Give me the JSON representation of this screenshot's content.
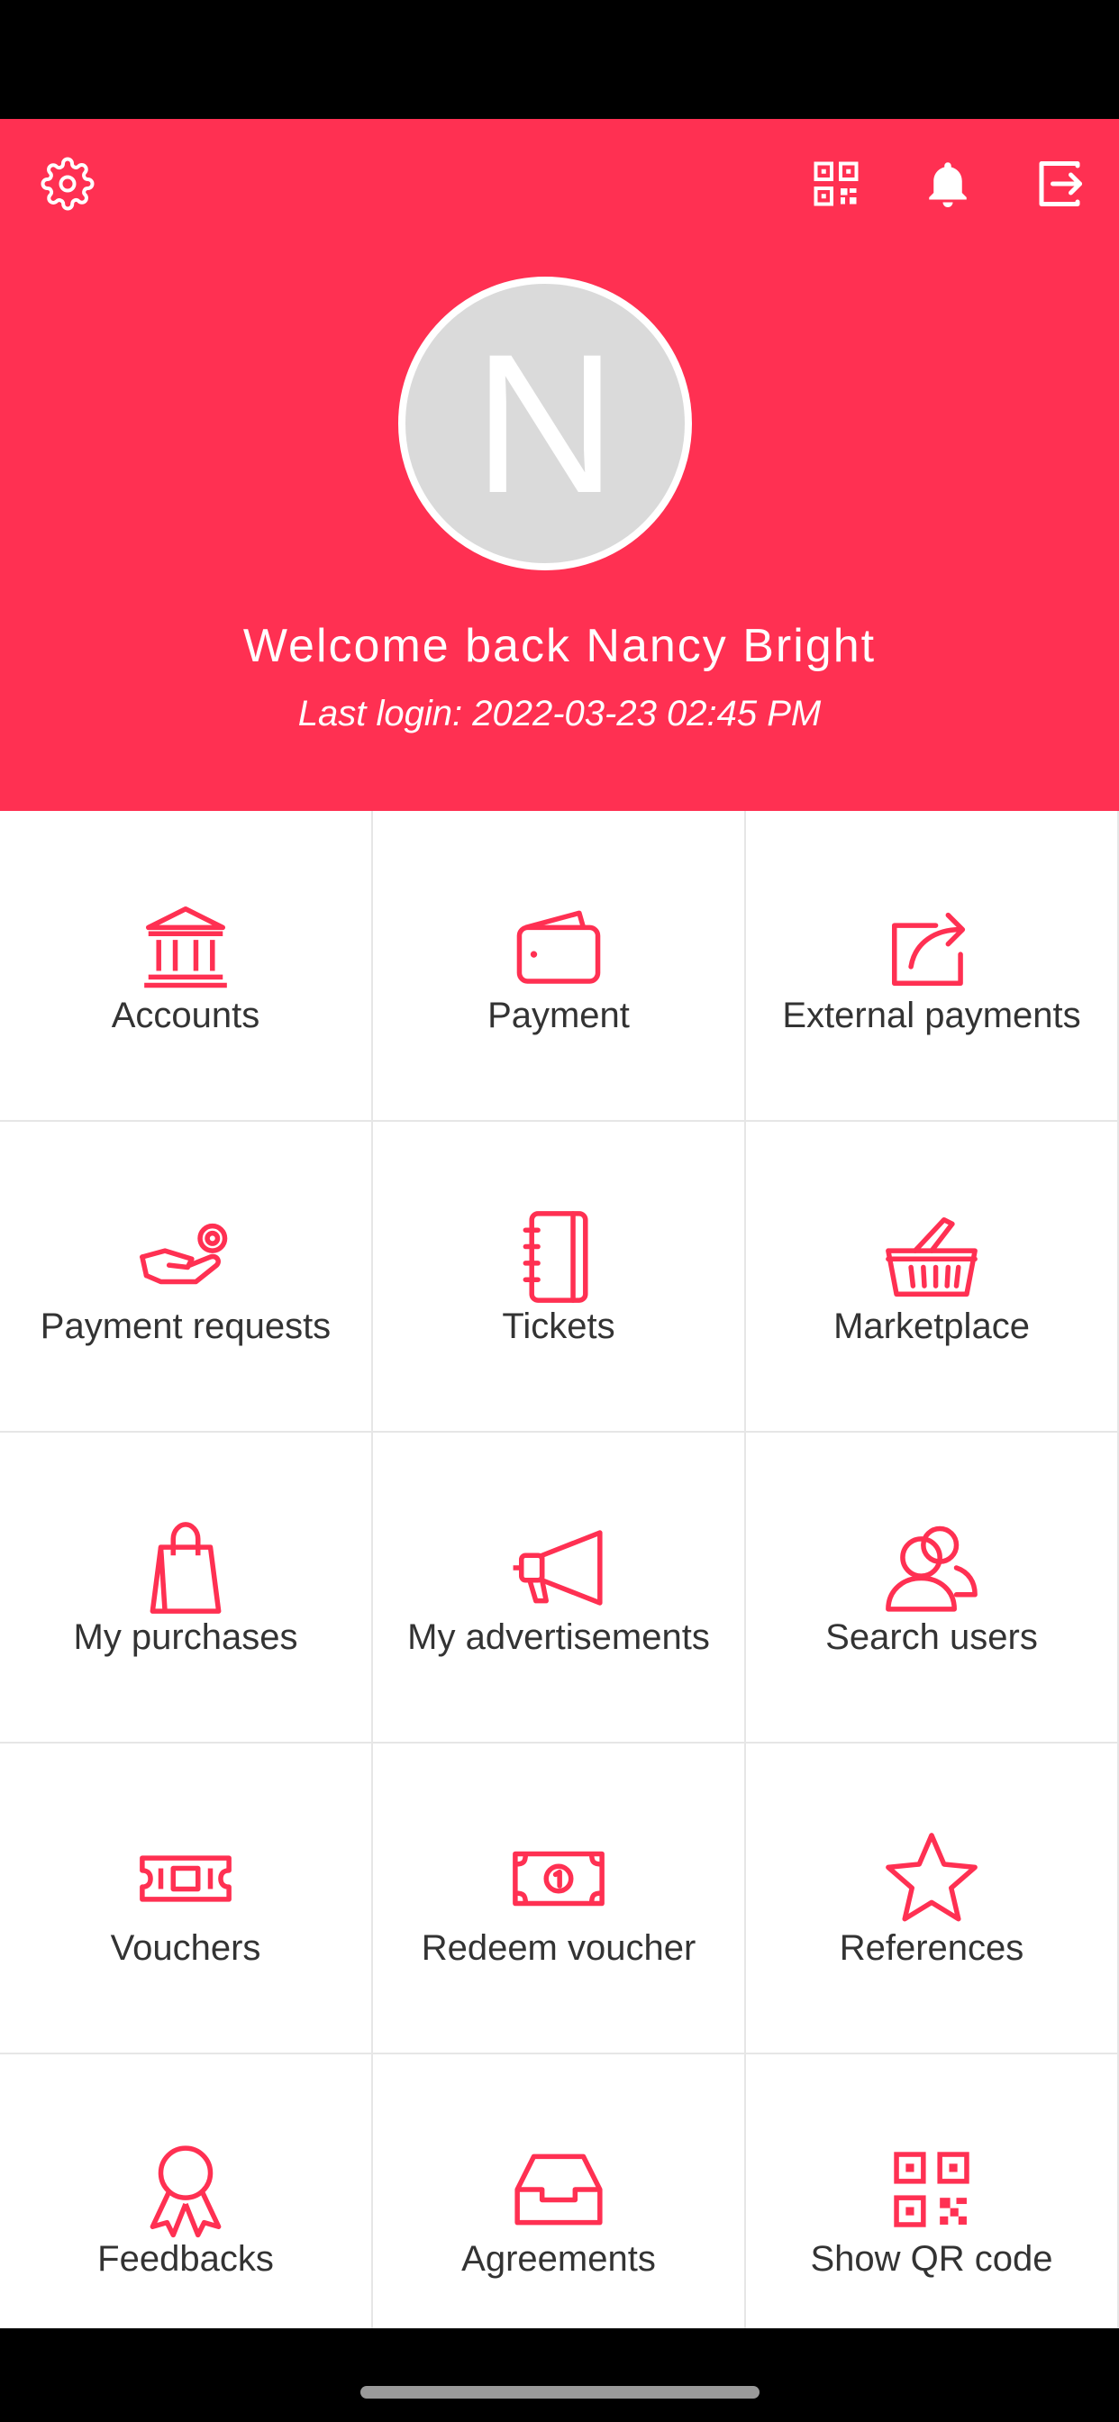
{
  "theme": {
    "accent": "#FF3052",
    "avatar_bg": "#DADADA",
    "text": "#333333",
    "divider": "#E6E6E6"
  },
  "header": {
    "icons": [
      "gear-icon",
      "qr-code-icon",
      "bell-icon",
      "logout-icon"
    ],
    "avatar_initial": "N",
    "welcome": "Welcome back Nancy Bright",
    "last_login": "Last login: 2022-03-23 02:45 PM"
  },
  "menu": {
    "items": [
      {
        "label": "Accounts",
        "icon": "bank-icon"
      },
      {
        "label": "Payment",
        "icon": "wallet-icon"
      },
      {
        "label": "External payments",
        "icon": "share-icon"
      },
      {
        "label": "Payment requests",
        "icon": "hand-coin-icon"
      },
      {
        "label": "Tickets",
        "icon": "notebook-icon"
      },
      {
        "label": "Marketplace",
        "icon": "basket-icon"
      },
      {
        "label": "My purchases",
        "icon": "shopping-bag-icon"
      },
      {
        "label": "My advertisements",
        "icon": "megaphone-icon"
      },
      {
        "label": "Search users",
        "icon": "users-icon"
      },
      {
        "label": "Vouchers",
        "icon": "ticket-icon"
      },
      {
        "label": "Redeem voucher",
        "icon": "banknote-icon"
      },
      {
        "label": "References",
        "icon": "star-icon"
      },
      {
        "label": "Feedbacks",
        "icon": "award-icon"
      },
      {
        "label": "Agreements",
        "icon": "inbox-icon"
      },
      {
        "label": "Show QR code",
        "icon": "qr-code-icon"
      }
    ]
  }
}
